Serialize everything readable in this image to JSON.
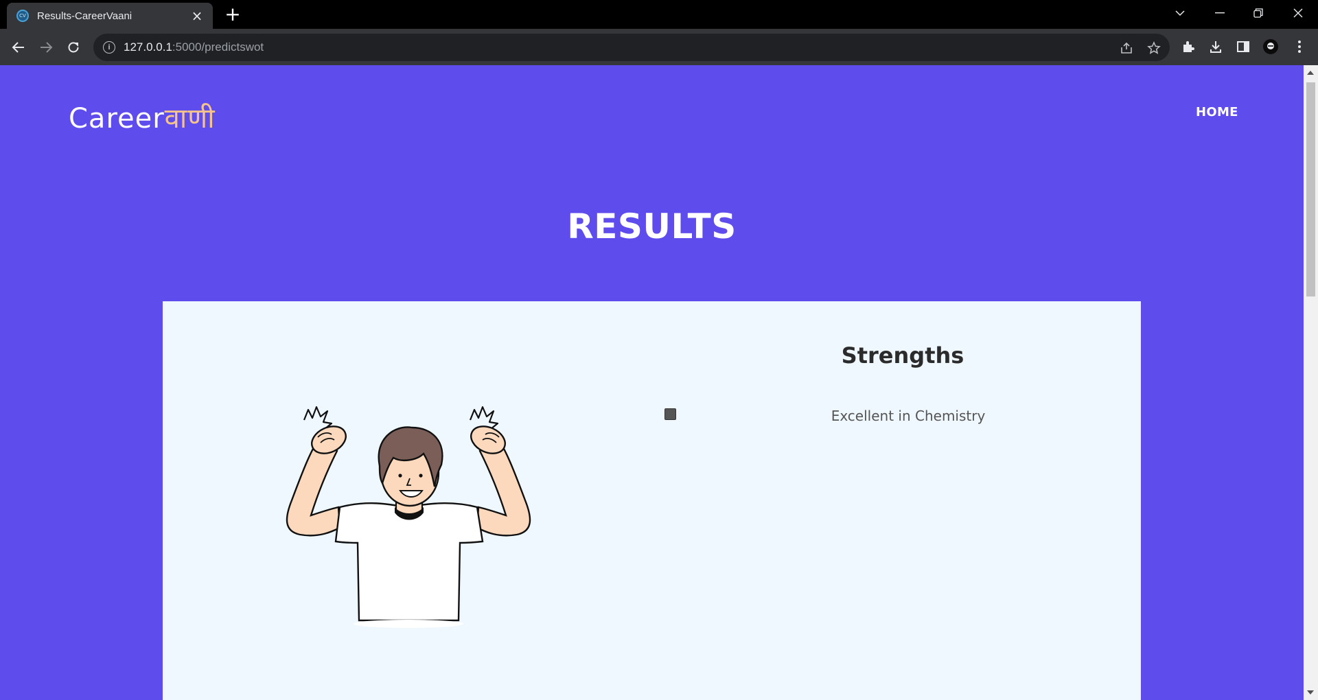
{
  "browser": {
    "tab_title": "Results-CareerVaani",
    "favicon_text": "CV",
    "url_host": "127.0.0.1",
    "url_rest": ":5000/predictswot"
  },
  "site": {
    "logo_latin": "Career",
    "logo_devanagari": "वाणी",
    "nav_home": "HOME"
  },
  "page": {
    "heading": "RESULTS"
  },
  "card": {
    "title": "Strengths",
    "items": [
      "Excellent in Chemistry"
    ]
  },
  "colors": {
    "page_bg": "#5f4ced",
    "card_bg": "#f0f8ff",
    "logo_accent": "#f6c48a"
  }
}
